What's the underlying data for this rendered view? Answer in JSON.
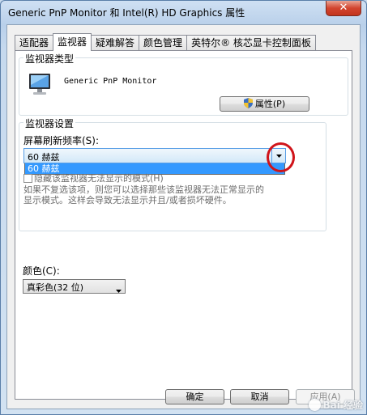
{
  "window": {
    "title": "Generic PnP Monitor 和 Intel(R) HD Graphics 属性",
    "close_label": "✕"
  },
  "tabs": [
    {
      "label": "适配器"
    },
    {
      "label": "监视器"
    },
    {
      "label": "疑难解答"
    },
    {
      "label": "颜色管理"
    },
    {
      "label": "英特尔® 核芯显卡控制面板"
    }
  ],
  "active_tab": "监视器",
  "monitor_type": {
    "group_label": "监视器类型",
    "monitor_name": "Generic PnP Monitor",
    "icon": "monitor-icon",
    "properties_button": "属性(P)"
  },
  "monitor_settings": {
    "group_label": "监视器设置",
    "refresh_label": "屏幕刷新频率(S):",
    "refresh_value": "60 赫兹",
    "dropdown_options": [
      "60 赫兹"
    ],
    "hide_modes_label": "隐藏该监视器无法显示的模式(H)",
    "help_line1": "如果不复选该项，则您可以选择那些该监视器无法正常显示的",
    "help_line2": "显示模式。这样会导致无法显示并且/或者损坏硬件。"
  },
  "colors": {
    "label": "颜色(C):",
    "value": "真彩色(32 位)"
  },
  "footer": {
    "ok": "确定",
    "cancel": "取消",
    "apply": "应用(A)"
  },
  "watermark": "Bai 经验",
  "accent": {
    "selection": "#3399ff",
    "callout": "#d0141a"
  }
}
